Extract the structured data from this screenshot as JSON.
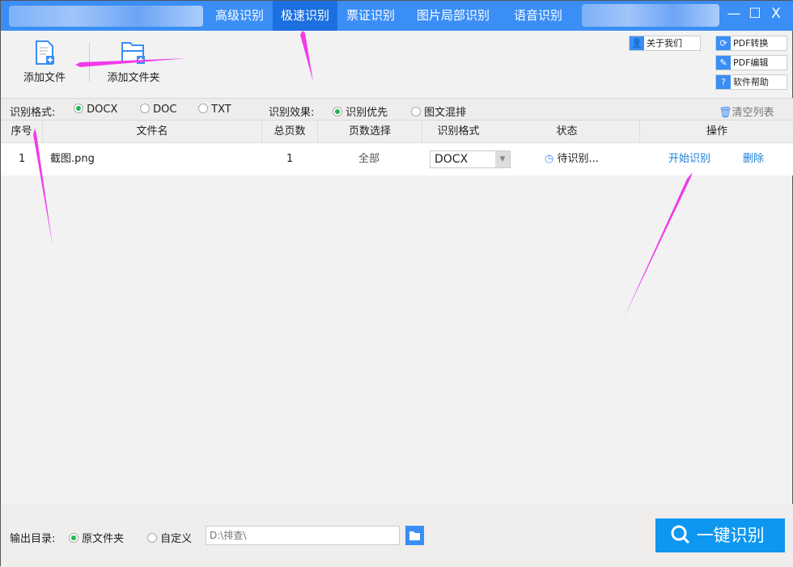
{
  "titlebar": {
    "tabs": [
      {
        "label": "高级识别"
      },
      {
        "label": "极速识别",
        "active": true
      },
      {
        "label": "票证识别"
      },
      {
        "label": "图片局部识别"
      },
      {
        "label": "语音识别"
      }
    ],
    "minimize": "—",
    "maximize": "☐",
    "close": "X"
  },
  "toolbar": {
    "add_file": "添加文件",
    "add_folder": "添加文件夹",
    "about": "关于我们",
    "pdf_convert": "PDF转换",
    "pdf_edit": "PDF编辑",
    "help": "软件帮助"
  },
  "options": {
    "format_label": "识别格式:",
    "formats": [
      {
        "label": "DOCX",
        "checked": true
      },
      {
        "label": "DOC",
        "checked": false
      },
      {
        "label": "TXT",
        "checked": false
      }
    ],
    "effect_label": "识别效果:",
    "effects": [
      {
        "label": "识别优先",
        "checked": true
      },
      {
        "label": "图文混排",
        "checked": false
      }
    ],
    "clear_list": "清空列表"
  },
  "table": {
    "headers": [
      "序号",
      "文件名",
      "总页数",
      "页数选择",
      "识别格式",
      "状态",
      "操作"
    ],
    "rows": [
      {
        "index": "1",
        "filename": "截图.png",
        "pages": "1",
        "page_select": "全部",
        "format": "DOCX",
        "status": "待识别...",
        "start": "开始识别",
        "delete": "删除"
      }
    ]
  },
  "footer": {
    "output_label": "输出目录:",
    "original_folder": "原文件夹",
    "custom": "自定义",
    "path_placeholder": "D:\\排查\\",
    "run_button": "一键识别"
  },
  "colors": {
    "accent": "#3a8ef6",
    "active_tab": "#1b6fe0",
    "run_button": "#0d97f0",
    "annotation": "#f03ce8",
    "link": "#1a7fd8"
  }
}
